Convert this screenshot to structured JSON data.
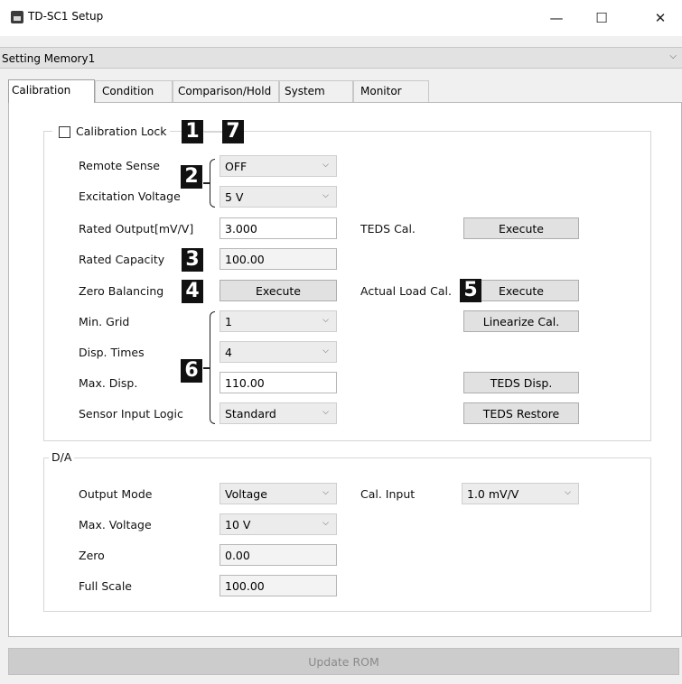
{
  "window": {
    "title": "TD-SC1 Setup",
    "minimize_glyph": "—",
    "maximize_glyph": "☐",
    "close_glyph": "✕"
  },
  "memory_select": {
    "value": "Setting Memory1"
  },
  "tabs": [
    {
      "label": "Calibration",
      "active": true
    },
    {
      "label": "Condition",
      "active": false
    },
    {
      "label": "Comparison/Hold",
      "active": false
    },
    {
      "label": "System",
      "active": false
    },
    {
      "label": "Monitor",
      "active": false
    }
  ],
  "calibration": {
    "lock_label": "Calibration Lock",
    "lock_checked": false,
    "remote_sense": {
      "label": "Remote Sense",
      "value": "OFF"
    },
    "excitation_voltage": {
      "label": "Excitation Voltage",
      "value": "5 V"
    },
    "rated_output": {
      "label": "Rated Output[mV/V]",
      "value": "3.000"
    },
    "rated_capacity": {
      "label": "Rated Capacity",
      "value": "100.00"
    },
    "zero_balancing": {
      "label": "Zero Balancing",
      "button": "Execute"
    },
    "min_grid": {
      "label": "Min. Grid",
      "value": "1"
    },
    "disp_times": {
      "label": "Disp. Times",
      "value": "4"
    },
    "max_disp": {
      "label": "Max. Disp.",
      "value": "110.00"
    },
    "sensor_input_logic": {
      "label": "Sensor Input Logic",
      "value": "Standard"
    },
    "teds_cal": {
      "label": "TEDS Cal.",
      "button": "Execute"
    },
    "actual_load_cal": {
      "label": "Actual Load Cal.",
      "button": "Execute"
    },
    "linearize_cal": {
      "button": "Linearize Cal."
    },
    "teds_disp": {
      "button": "TEDS Disp."
    },
    "teds_restore": {
      "button": "TEDS Restore"
    }
  },
  "da": {
    "group_label": "D/A",
    "output_mode": {
      "label": "Output Mode",
      "value": "Voltage"
    },
    "cal_input": {
      "label": "Cal. Input",
      "value": "1.0 mV/V"
    },
    "max_voltage": {
      "label": "Max. Voltage",
      "value": "10 V"
    },
    "zero": {
      "label": "Zero",
      "value": "0.00"
    },
    "full_scale": {
      "label": "Full Scale",
      "value": "100.00"
    }
  },
  "update_rom": {
    "label": "Update ROM",
    "enabled": false
  },
  "badges": [
    "1",
    "7",
    "2",
    "3",
    "4",
    "5",
    "6"
  ],
  "chevron_glyph": "⌵"
}
